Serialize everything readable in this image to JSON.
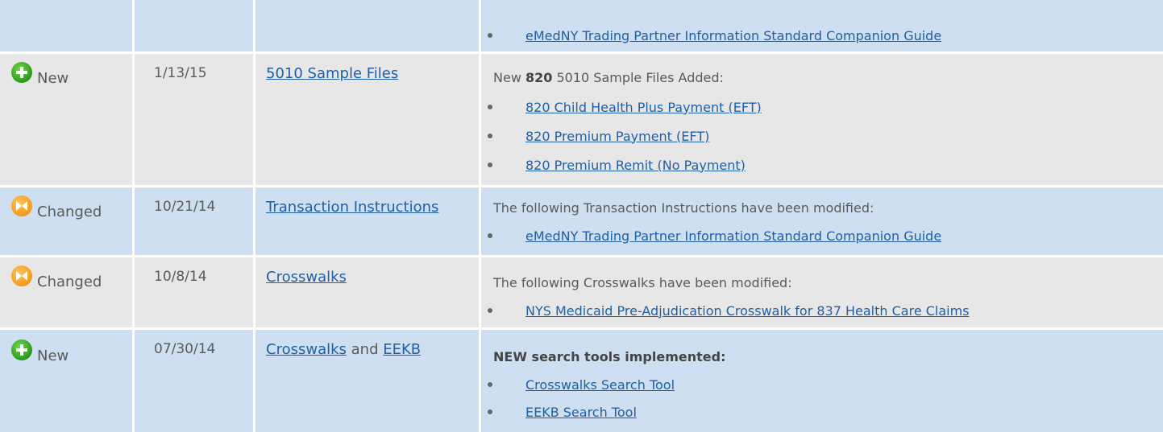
{
  "rows": [
    {
      "status": "",
      "date": "",
      "description": {
        "items": [
          "eMedNY Trading Partner Information Standard Companion Guide"
        ]
      }
    },
    {
      "status": "New",
      "date": "1/13/15",
      "section_link": "5010 Sample Files",
      "description": {
        "intro_pre": "New ",
        "intro_bold": "820",
        "intro_post": " 5010 Sample Files Added:",
        "items": [
          "820 Child Health Plus Payment (EFT)",
          "820 Premium Payment (EFT)",
          "820 Premium Remit (No Payment)"
        ]
      }
    },
    {
      "status": "Changed",
      "date": "10/21/14",
      "section_link": "Transaction Instructions",
      "description": {
        "intro": "The following Transaction Instructions have been modified:",
        "items": [
          "eMedNY Trading Partner Information Standard Companion Guide"
        ]
      }
    },
    {
      "status": "Changed",
      "date": "10/8/14",
      "section_link": "Crosswalks",
      "description": {
        "intro": "The following Crosswalks have been modified:",
        "items": [
          "NYS Medicaid Pre-Adjudication Crosswalk for 837 Health Care Claims"
        ]
      }
    },
    {
      "status": "New",
      "date": "07/30/14",
      "section_link": "Crosswalks",
      "section_connector": " and ",
      "section_link_2": "EEKB",
      "description": {
        "intro_bold": "NEW search tools implemented:",
        "items": [
          "Crosswalks Search Tool",
          "EEKB Search Tool"
        ]
      }
    }
  ],
  "colors": {
    "row_blue": "#cddff0",
    "row_gray": "#e7e7e7",
    "link": "#1f5fa6",
    "new_icon": "#2a9a18",
    "changed_icon": "#f39a1a"
  }
}
